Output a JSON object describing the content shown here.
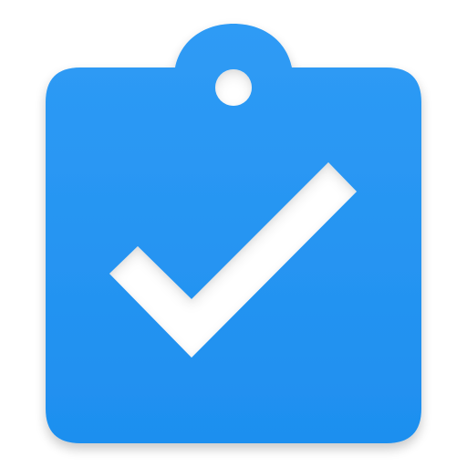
{
  "icon": {
    "name": "clipboard-check-icon",
    "colors": {
      "body_top": "#2f9bf5",
      "body_bottom": "#1e8fef",
      "check": "#ffffff",
      "hole": "#ffffff",
      "shadow": "#000000"
    }
  }
}
